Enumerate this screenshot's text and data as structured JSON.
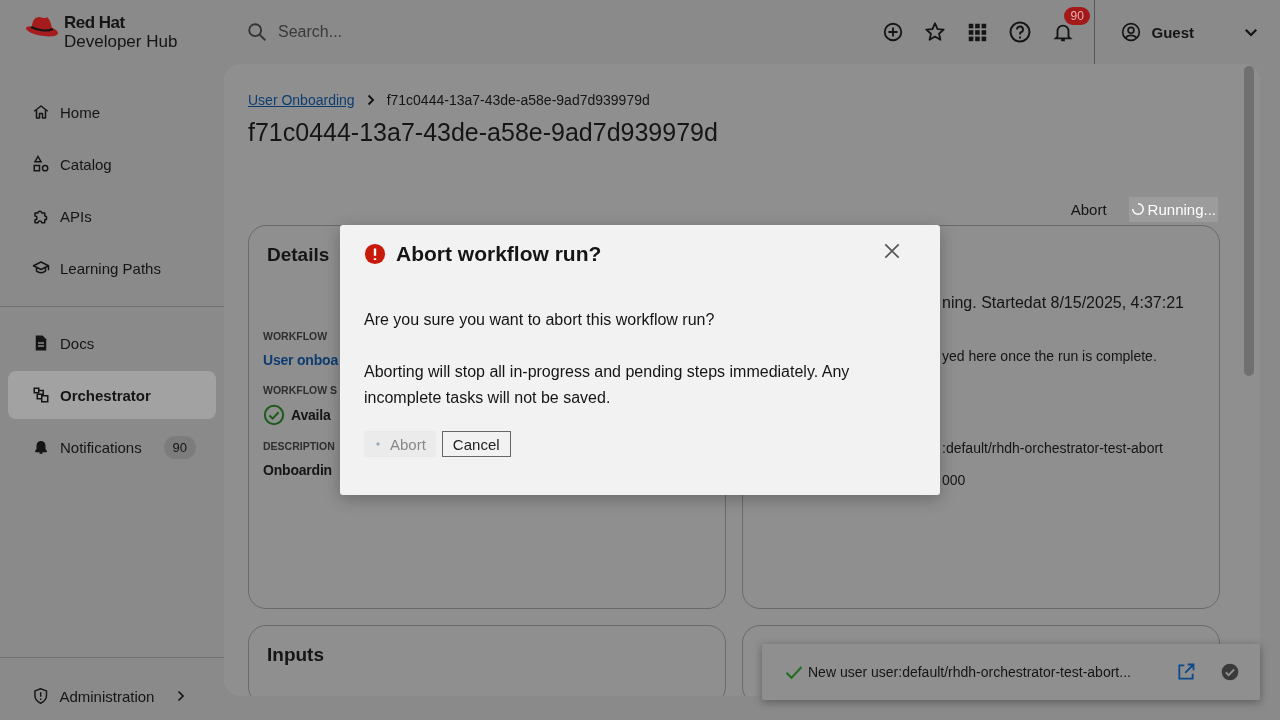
{
  "header": {
    "logo": {
      "line1": "Red Hat",
      "line2": "Developer Hub"
    },
    "search": {
      "placeholder": "Search..."
    },
    "notification_count": "90",
    "user": "Guest"
  },
  "sidebar": {
    "groups": [
      [
        {
          "label": "Home",
          "kind": "home",
          "selected": false
        },
        {
          "label": "Catalog",
          "kind": "catalog",
          "selected": false
        },
        {
          "label": "APIs",
          "kind": "puzzle",
          "selected": false
        },
        {
          "label": "Learning Paths",
          "kind": "school",
          "selected": false
        }
      ],
      [
        {
          "label": "Docs",
          "kind": "doc",
          "selected": false
        },
        {
          "label": "Orchestrator",
          "kind": "flow",
          "selected": true
        },
        {
          "label": "Notifications",
          "kind": "bell",
          "selected": false,
          "badge": "90"
        }
      ]
    ],
    "bottom": {
      "label": "Administration",
      "kind": "shield"
    }
  },
  "breadcrumb": {
    "link": "User Onboarding",
    "current": "f71c0444-13a7-43de-a58e-9ad7d939979d"
  },
  "title": "f71c0444-13a7-43de-a58e-9ad7d939979d",
  "actions": [
    {
      "label": "Abort",
      "kind": "text",
      "disabled": false
    },
    {
      "label": "Running...",
      "kind": "progress",
      "disabled": true
    }
  ],
  "details": {
    "title": "Details",
    "fields": [
      {
        "label": "WORKFLOW",
        "value": "User onboa",
        "kind": "link"
      },
      {
        "label": "WORKFLOW S",
        "value": "Availa",
        "kind": "check"
      },
      {
        "label": "DESCRIPTION",
        "value": "Onboardin",
        "kind": "text"
      }
    ]
  },
  "results": {
    "message": "ning. Startedat 8/15/2025, 4:37:21",
    "note": "yed here once the run is complete.",
    "values": [
      {
        "value": ":default/rhdh-orchestrator-test-abort"
      },
      {
        "value": "000"
      }
    ]
  },
  "inputs": {
    "title": "Inputs"
  },
  "dialog": {
    "title": "Abort workflow run?",
    "paragraphs": [
      "Are you sure you want to abort this workflow run?",
      "Aborting will stop all in-progress and pending steps immediately. Any incomplete tasks will not be saved."
    ],
    "buttons": [
      {
        "label": "Abort",
        "kind": "danger",
        "disabled": true
      },
      {
        "label": "Cancel",
        "kind": "secondary",
        "disabled": false
      }
    ]
  },
  "toast": {
    "message": "New user user:default/rhdh-orchestrator-test-abort...",
    "kind": "success"
  }
}
